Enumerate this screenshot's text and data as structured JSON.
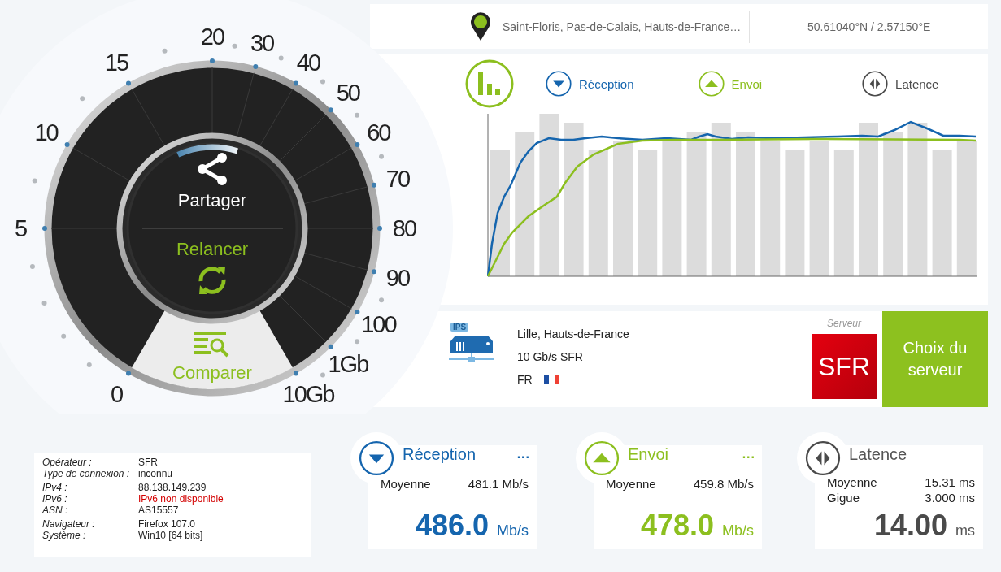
{
  "location": {
    "place": "Saint-Floris, Pas-de-Calais, Hauts-de-France…",
    "coordinates": "50.61040°N / 2.57150°E"
  },
  "gauge": {
    "scale": [
      "0",
      "5",
      "10",
      "15",
      "20",
      "30",
      "40",
      "50",
      "60",
      "70",
      "80",
      "90",
      "100",
      "1Gb",
      "10Gb"
    ],
    "share": "Partager",
    "restart": "Relancer",
    "compare": "Comparer"
  },
  "chart": {
    "legend": [
      {
        "kind": "download",
        "label": "Réception"
      },
      {
        "kind": "upload",
        "label": "Envoi"
      },
      {
        "kind": "latency",
        "label": "Latence"
      }
    ]
  },
  "server": {
    "icon_tag": "IPS",
    "city": "Lille, Hauts-de-France",
    "link": "10 Gb/s SFR",
    "country": "FR",
    "caption": "Serveur",
    "logo": "SFR",
    "button": "Choix du serveur"
  },
  "connection": [
    {
      "rows": [
        {
          "label": "Opérateur :",
          "value": "SFR",
          "kind": "normal"
        },
        {
          "label": "Type de connexion :",
          "value": "inconnu",
          "kind": "normal"
        }
      ]
    },
    {
      "rows": [
        {
          "label": "IPv4 :",
          "value": "88.138.149.239",
          "kind": "normal"
        },
        {
          "label": "IPv6 :",
          "value": "IPv6 non disponible",
          "kind": "unavailable"
        },
        {
          "label": "ASN :",
          "value": "AS15557",
          "kind": "normal"
        }
      ]
    },
    {
      "rows": [
        {
          "label": "Navigateur :",
          "value": "Firefox 107.0",
          "kind": "normal"
        },
        {
          "label": "Système :",
          "value": "Win10 [64 bits]",
          "kind": "normal"
        }
      ]
    }
  ],
  "results": [
    {
      "kind": "download",
      "title": "Réception",
      "more": "...",
      "rows": [
        {
          "label": "Moyenne",
          "value": "481.1 Mb/s"
        }
      ],
      "value": "486.0",
      "unit": "Mb/s"
    },
    {
      "kind": "upload",
      "title": "Envoi",
      "more": "...",
      "rows": [
        {
          "label": "Moyenne",
          "value": "459.8 Mb/s"
        }
      ],
      "value": "478.0",
      "unit": "Mb/s"
    },
    {
      "kind": "latency",
      "title": "Latence",
      "rows": [
        {
          "label": "Moyenne",
          "value": "15.31 ms"
        },
        {
          "label": "Gigue",
          "value": "3.000 ms"
        }
      ],
      "value": "14.00",
      "unit": "ms"
    }
  ]
}
